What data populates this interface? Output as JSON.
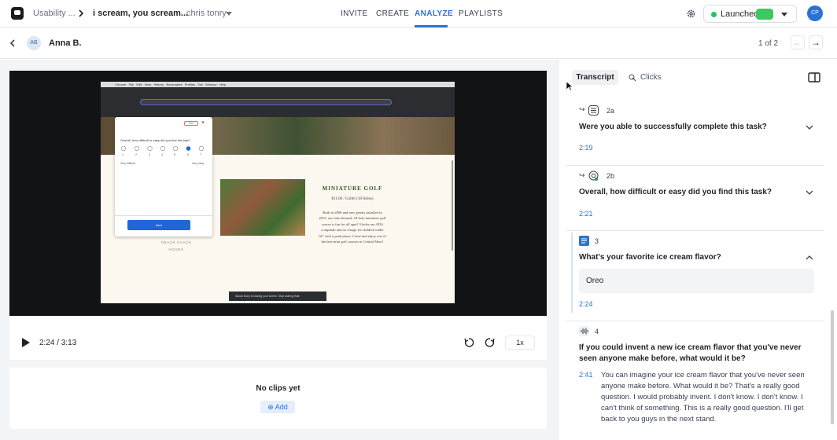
{
  "topbar": {
    "crumbs": [
      "Usability ...",
      "i scream, you scream...",
      "chris tonry"
    ],
    "tabs": [
      "INVITE",
      "CREATE",
      "ANALYZE",
      "PLAYLISTS"
    ],
    "active_tab": "ANALYZE",
    "launch_label": "Launched",
    "accent": "#2a72d8"
  },
  "session": {
    "avatar": "AB",
    "name": "Anna B.",
    "pager": "1 of 2"
  },
  "player": {
    "time": "2:24 / 3:13",
    "speed": "1x",
    "progress_fraction": 0.75,
    "screen": {
      "menu": [
        "Chrome",
        "File",
        "Edit",
        "View",
        "History",
        "Bookmarks",
        "Profiles",
        "Tab",
        "Window",
        "Help"
      ],
      "survey": {
        "question": "Overall, how difficult or easy did you find this task?",
        "scale": [
          "1",
          "2",
          "3",
          "4",
          "5",
          "6",
          "7"
        ],
        "low": "Very difficult",
        "high": "Very easy",
        "next": "Next",
        "badge": "Pee"
      },
      "site": {
        "heading": "MINIATURE GOLF",
        "price": "$11.00 / Golfer (18 Holes)",
        "body": "Built in 2006 and new greens installed in 2015, our farm themed, 18 hole miniature golf course is fun for all ages! 9 holes are ADA compliant and no charge for children under 56\" with a paid player. Come and enjoy one of the best mini golf courses in Central Mass!",
        "side": "SNACK SHACK HOURS"
      },
      "share_bar": "dscout Diary is sharing your screen.  Stop sharing  Hide"
    }
  },
  "clips": {
    "empty_label": "No clips yet",
    "add_label": "Add"
  },
  "panel": {
    "tabs": [
      "Transcript",
      "Clicks"
    ],
    "active_tab": "Transcript",
    "items": [
      {
        "num": "2a",
        "question": "Were you able to successfully complete this task?",
        "time": "2:19",
        "icon": "list-icon",
        "expanded": false
      },
      {
        "num": "2b",
        "question": "Overall, how difficult or easy did you find this task?",
        "time": "2:21",
        "icon": "target-icon",
        "expanded": false
      },
      {
        "num": "3",
        "question": "What's your favorite ice cream flavor?",
        "time": "2:24",
        "icon": "text-icon",
        "answer": "Oreo",
        "expanded": true
      },
      {
        "num": "4",
        "question": "If you could invent a new ice cream flavor that you've never seen anyone make before, what would it be?",
        "time": "2:41",
        "icon": "audio-icon",
        "transcript": "You can imagine your ice cream flavor that you've never seen anyone make before. What would it be? That's a really good question. I would probably invent. I don't know. I don't know. I can't think of something. This is a really good question. I'll get back to you guys in the next stand."
      }
    ]
  }
}
